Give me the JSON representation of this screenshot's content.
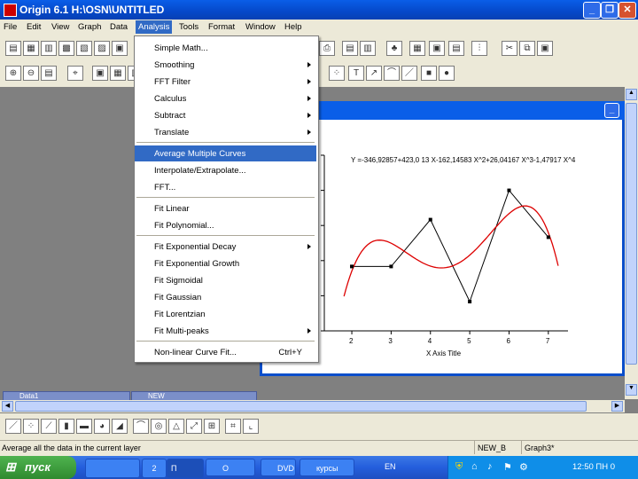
{
  "app": {
    "title": "Origin 6.1 - H:\\OSN\\UNTITLED",
    "title_display": "Origin 6.1   H:\\OSN\\UNTITLED"
  },
  "menubar": {
    "items": [
      "File",
      "Edit",
      "View",
      "Graph",
      "Data",
      "Analysis",
      "Tools",
      "Format",
      "Window",
      "Help"
    ],
    "active": "Analysis"
  },
  "analysis_menu": {
    "items": [
      {
        "label": "Simple Math...",
        "submenu": false
      },
      {
        "label": "Smoothing",
        "submenu": true
      },
      {
        "label": "FFT Filter",
        "submenu": true
      },
      {
        "label": "Calculus",
        "submenu": true
      },
      {
        "label": "Subtract",
        "submenu": true
      },
      {
        "label": "Translate",
        "submenu": true
      },
      {
        "label": "Average Multiple Curves",
        "submenu": false,
        "highlighted": true
      },
      {
        "label": "Interpolate/Extrapolate...",
        "submenu": false
      },
      {
        "label": "FFT...",
        "submenu": false
      },
      {
        "label": "Fit Linear",
        "submenu": false
      },
      {
        "label": "Fit Polynomial...",
        "submenu": false
      },
      {
        "label": "Fit Exponential Decay",
        "submenu": true
      },
      {
        "label": "Fit Exponential Growth",
        "submenu": false
      },
      {
        "label": "Fit Sigmoidal",
        "submenu": false
      },
      {
        "label": "Fit Gaussian",
        "submenu": false
      },
      {
        "label": "Fit Lorentzian",
        "submenu": false
      },
      {
        "label": "Fit Multi-peaks",
        "submenu": true
      },
      {
        "label": "Non-linear Curve Fit...",
        "submenu": false,
        "shortcut": "Ctrl+Y"
      }
    ]
  },
  "graph": {
    "equation": "Y =-346,92857+423,0 13 X-162,14583 X^2+26,04167 X^3-1,47917 X^4",
    "xlabel": "X Axis Title",
    "x_ticks": [
      "2",
      "3",
      "4",
      "5",
      "6",
      "7"
    ]
  },
  "chart_data": {
    "type": "line",
    "x": [
      2,
      3,
      4,
      5,
      6,
      7
    ],
    "series": [
      {
        "values": [
          42,
          42,
          58,
          30,
          68,
          52
        ],
        "color": "#000000"
      },
      {
        "values_note": "",
        "color": "#dd0000",
        "fit": "polynomial order 4"
      }
    ],
    "xlabel": "X Axis Title",
    "title": "Y =-346,92857+423,0 13 X-162,14583 X^2+26,04167 X^3-1,47917 X^4"
  },
  "minimized_windows": [
    "Data1",
    "NEW"
  ],
  "status": {
    "message": "Average all the data in the current layer",
    "panel1": "NEW_B",
    "panel2": "Graph3*"
  },
  "taskbar": {
    "start": "пуск",
    "items": [
      "2",
      "П",
      "O",
      "DVD",
      "курсы"
    ],
    "lang": "EN",
    "clock": "12:50 ПН 0"
  },
  "colors": {
    "titlebar": "#0a5ee8",
    "menu_highlight": "#316ac5",
    "fit_curve": "#dd0000",
    "data_line": "#000000"
  }
}
